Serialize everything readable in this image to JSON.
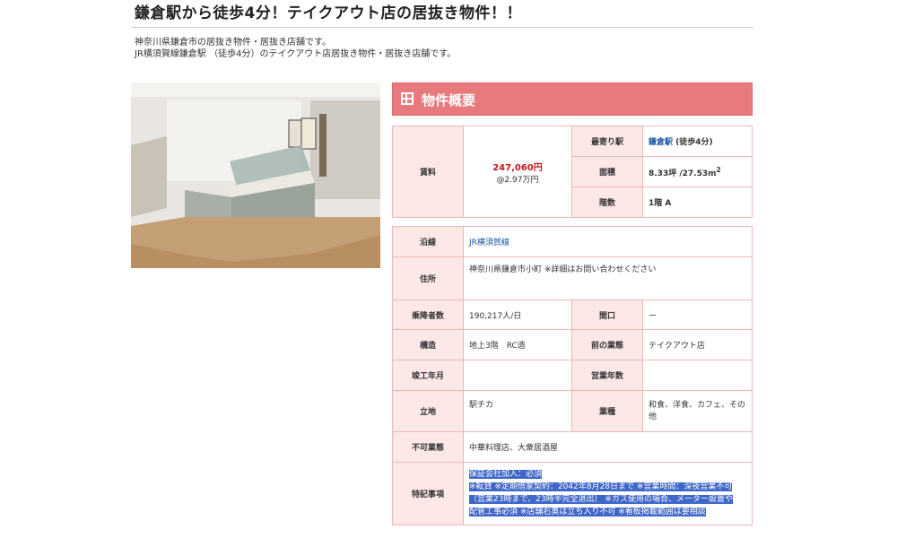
{
  "page": {
    "title": "鎌倉駅から徒歩4分！テイクアウト店の居抜き物件！！",
    "intro_line1": "神奈川県鎌倉市の居抜き物件・居抜き店舗です。",
    "intro_line2": "JR横須賀線鎌倉駅 （徒歩4分）のテイクアウト店居抜き物件・居抜き店舗です。"
  },
  "panel": {
    "title": "物件概要",
    "icon": "grid-icon"
  },
  "summary": {
    "rent_label": "賃料",
    "rent_value": "247,060円",
    "rent_unit": "@2.97万円",
    "station_label": "最寄り駅",
    "station_name": "鎌倉駅",
    "station_walk": " (徒歩4分)",
    "area_label": "面積",
    "area_value": "8.33坪 /27.53m",
    "area_sup": "2",
    "floor_label": "階数",
    "floor_value": "1階 A"
  },
  "details": {
    "line_label": "沿線",
    "line_value": "JR横須賀線",
    "address_label": "住所",
    "address_value": "神奈川県鎌倉市小町 ※詳細はお問い合わせください",
    "passengers_label": "乗降者数",
    "passengers_value": "190,217人/日",
    "frontage_label": "間口",
    "frontage_value": "ー",
    "structure_label": "構造",
    "structure_value": "地上3階　RC造",
    "prev_business_label": "前の業態",
    "prev_business_value": "テイクアウト店",
    "built_label": "竣工年月",
    "built_value": "",
    "years_label": "営業年数",
    "years_value": "",
    "location_label": "立地",
    "location_value": "駅チカ",
    "category_label": "業種",
    "category_value": "和食、洋食、カフェ、その他",
    "prohibited_label": "不可業態",
    "prohibited_value": "中華料理店、大衆居酒屋",
    "notes_label": "特記事項",
    "notes_line1": "保証会社加入：必須",
    "notes_line2": "※転貸 ※定期借家契約：2042年8月28日まで ※営業時間：深夜営業不可",
    "notes_line3": "（営業23時まで、23時半完全退出） ※ガス使用の場合、メーター設置や",
    "notes_line4": "配管工事必須 ※店舗右奥は立ち入り不可 ※看板掲載範囲は要相談"
  },
  "colors": {
    "accent": "#e87a7d",
    "header_cell": "#fde8e8",
    "price": "#c8151b",
    "link": "#1a56a6",
    "selection": "#3f66c9"
  }
}
